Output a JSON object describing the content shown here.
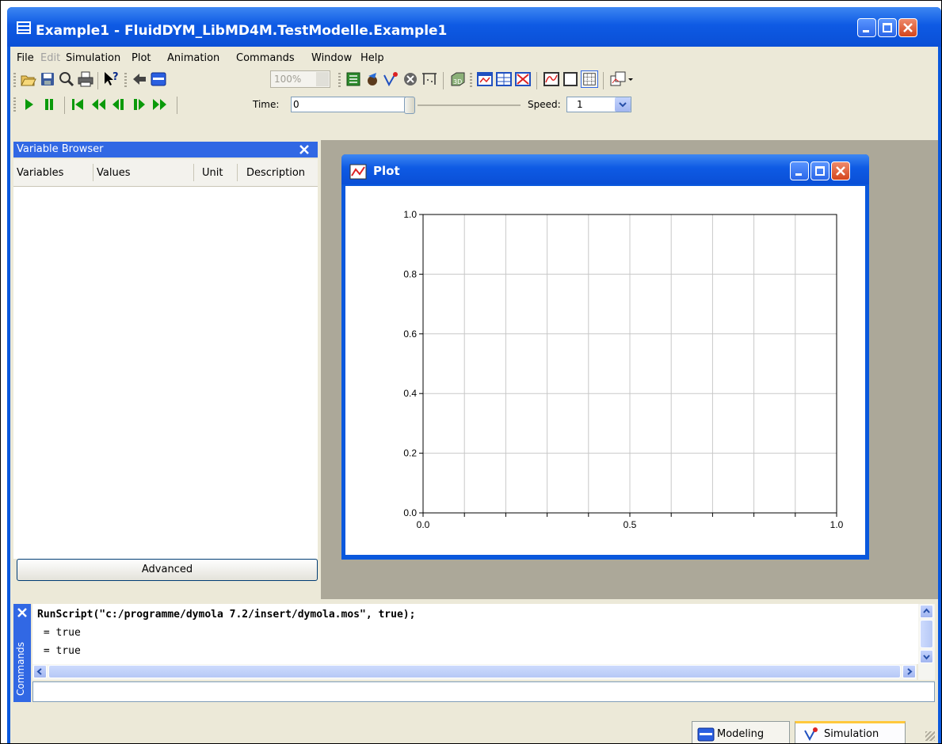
{
  "window": {
    "title": "Example1 - FluidDYM_LibMD4M.TestModelle.Example1"
  },
  "menu": {
    "items": [
      "File",
      "Edit",
      "Simulation",
      "Plot",
      "Animation",
      "Commands",
      "Window",
      "Help"
    ]
  },
  "toolbar": {
    "zoom_value": "100%",
    "time_label": "Time:",
    "time_value": "0",
    "speed_label": "Speed:",
    "speed_value": "1"
  },
  "variable_browser": {
    "title": "Variable Browser",
    "columns": [
      "Variables",
      "Values",
      "Unit",
      "Description"
    ],
    "advanced_label": "Advanced"
  },
  "plot": {
    "title": "Plot"
  },
  "chart_data": {
    "type": "line",
    "series": [],
    "xlim": [
      0.0,
      1.0
    ],
    "ylim": [
      0.0,
      1.0
    ],
    "x_ticks": [
      "0.0",
      "0.5",
      "1.0"
    ],
    "y_ticks": [
      "0.0",
      "0.2",
      "0.4",
      "0.6",
      "0.8",
      "1.0"
    ],
    "grid": true
  },
  "commands": {
    "sidebar_label": "Commands",
    "lines": [
      "RunScript(\"c:/programme/dymola 7.2/insert/dymola.mos\", true);",
      " = true",
      " = true"
    ],
    "input_value": ""
  },
  "tabs": {
    "modeling": "Modeling",
    "simulation": "Simulation"
  }
}
